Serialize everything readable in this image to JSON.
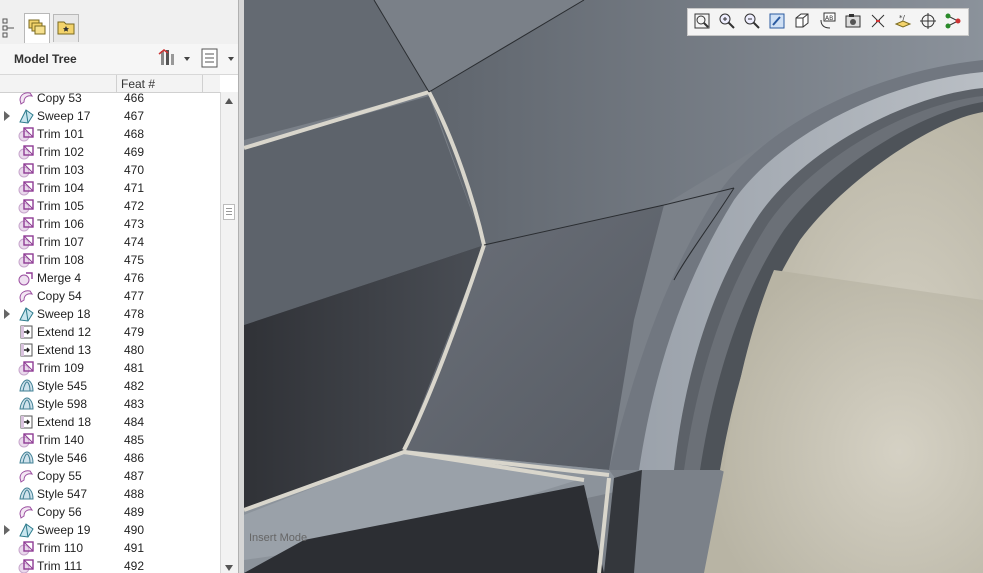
{
  "panel": {
    "title": "Model Tree",
    "column_header": "Feat #"
  },
  "tree_rows": [
    {
      "name": "Copy 53",
      "num": "466",
      "icon": "copy-icon",
      "expandable": false
    },
    {
      "name": "Sweep 17",
      "num": "467",
      "icon": "sweep-icon",
      "expandable": true
    },
    {
      "name": "Trim 101",
      "num": "468",
      "icon": "trim-icon",
      "expandable": false
    },
    {
      "name": "Trim 102",
      "num": "469",
      "icon": "trim-icon",
      "expandable": false
    },
    {
      "name": "Trim 103",
      "num": "470",
      "icon": "trim-icon",
      "expandable": false
    },
    {
      "name": "Trim 104",
      "num": "471",
      "icon": "trim-icon",
      "expandable": false
    },
    {
      "name": "Trim 105",
      "num": "472",
      "icon": "trim-icon",
      "expandable": false
    },
    {
      "name": "Trim 106",
      "num": "473",
      "icon": "trim-icon",
      "expandable": false
    },
    {
      "name": "Trim 107",
      "num": "474",
      "icon": "trim-icon",
      "expandable": false
    },
    {
      "name": "Trim 108",
      "num": "475",
      "icon": "trim-icon",
      "expandable": false
    },
    {
      "name": "Merge 4",
      "num": "476",
      "icon": "merge-icon",
      "expandable": false
    },
    {
      "name": "Copy 54",
      "num": "477",
      "icon": "copy-icon",
      "expandable": false
    },
    {
      "name": "Sweep 18",
      "num": "478",
      "icon": "sweep-icon",
      "expandable": true
    },
    {
      "name": "Extend 12",
      "num": "479",
      "icon": "extend-icon",
      "expandable": false
    },
    {
      "name": "Extend 13",
      "num": "480",
      "icon": "extend-icon",
      "expandable": false
    },
    {
      "name": "Trim 109",
      "num": "481",
      "icon": "trim-icon",
      "expandable": false
    },
    {
      "name": "Style 545",
      "num": "482",
      "icon": "style-icon",
      "expandable": false
    },
    {
      "name": "Style 598",
      "num": "483",
      "icon": "style-icon",
      "expandable": false
    },
    {
      "name": "Extend 18",
      "num": "484",
      "icon": "extend-icon",
      "expandable": false
    },
    {
      "name": "Trim 140",
      "num": "485",
      "icon": "trim-icon",
      "expandable": false
    },
    {
      "name": "Style 546",
      "num": "486",
      "icon": "style-icon",
      "expandable": false
    },
    {
      "name": "Copy 55",
      "num": "487",
      "icon": "copy-icon",
      "expandable": false
    },
    {
      "name": "Style 547",
      "num": "488",
      "icon": "style-icon",
      "expandable": false
    },
    {
      "name": "Copy 56",
      "num": "489",
      "icon": "copy-icon",
      "expandable": false
    },
    {
      "name": "Sweep 19",
      "num": "490",
      "icon": "sweep-icon",
      "expandable": true
    },
    {
      "name": "Trim 110",
      "num": "491",
      "icon": "trim-icon",
      "expandable": false
    },
    {
      "name": "Trim 111",
      "num": "492",
      "icon": "trim-icon",
      "expandable": false
    }
  ],
  "viewport": {
    "mode_label": "Insert Mode"
  },
  "view_toolbar": [
    "refit-icon",
    "zoom-in-icon",
    "zoom-out-icon",
    "repaint-icon",
    "display-style-icon",
    "saved-orientations-icon",
    "view-manager-icon",
    "perspective-icon",
    "datum-display-icon",
    "spin-center-icon",
    "annotation-display-icon"
  ],
  "colors": {
    "surface_light": "#9aa1aa",
    "surface_dark": "#3a3d42",
    "background": "#c9c5b6",
    "edge": "#d9d6cc"
  }
}
